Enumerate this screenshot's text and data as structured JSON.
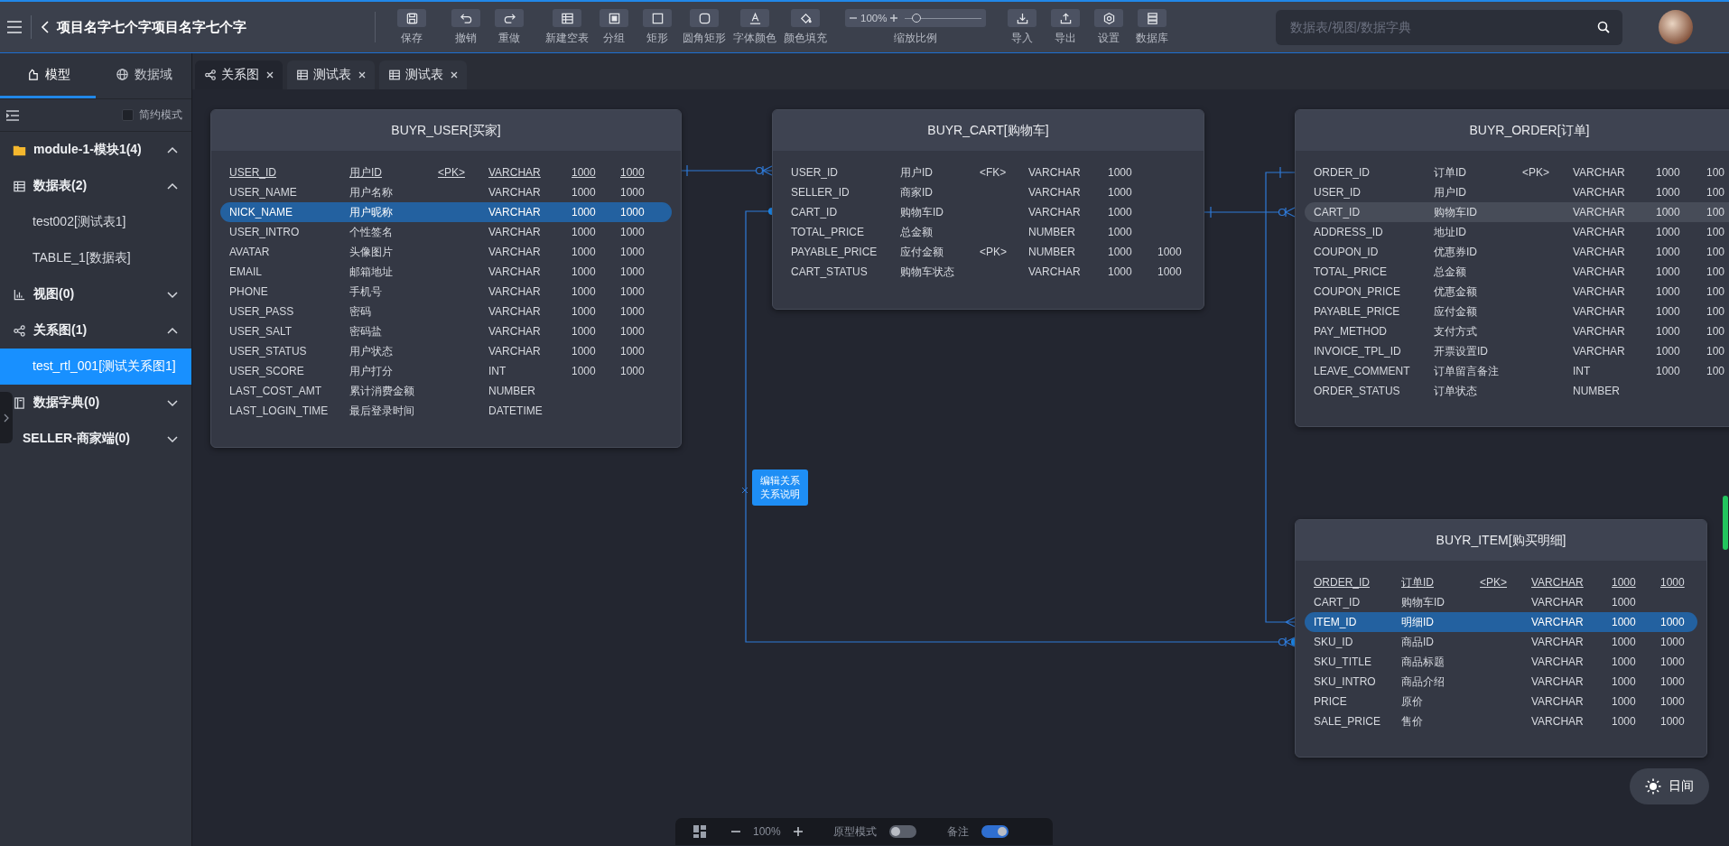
{
  "header": {
    "title": "项目名字七个字项目名字七个字"
  },
  "toolbar": {
    "groups": [
      [
        {
          "label": "保存"
        }
      ],
      [
        {
          "label": "撤销"
        },
        {
          "label": "重做"
        }
      ],
      [
        {
          "label": "新建空表"
        },
        {
          "label": "分组"
        },
        {
          "label": "矩形"
        },
        {
          "label": "圆角矩形"
        },
        {
          "label": "字体颜色"
        },
        {
          "label": "颜色填充"
        }
      ]
    ],
    "zoom": {
      "value": "100%",
      "level": 0.15,
      "label": "缩放比例"
    },
    "right_group": [
      {
        "label": "导入"
      },
      {
        "label": "导出"
      },
      {
        "label": "设置"
      },
      {
        "label": "数据库"
      }
    ]
  },
  "search": {
    "placeholder": "数据表/视图/数据字典"
  },
  "sidebar": {
    "tabs": [
      {
        "label": "模型",
        "selected": true
      },
      {
        "label": "数据域",
        "selected": false
      }
    ],
    "simple_mode": {
      "label": "简约模式",
      "checked": false
    },
    "tree": [
      {
        "label": "module-1-模块1(4)",
        "kind": "module",
        "expanded": true,
        "selected": false,
        "children": [
          {
            "label": "数据表(2)",
            "kind": "tables",
            "expanded": true,
            "selected": false,
            "children": [
              {
                "label": "test002[测试表1]",
                "selected": false
              },
              {
                "label": "TABLE_1[数据表]",
                "selected": false
              }
            ]
          },
          {
            "label": "视图(0)",
            "kind": "views",
            "expanded": false,
            "selected": false
          },
          {
            "label": "关系图(1)",
            "kind": "diagrams",
            "expanded": true,
            "selected": false,
            "children": [
              {
                "label": "test_rtl_001[测试关系图1]",
                "selected": true
              }
            ]
          },
          {
            "label": "数据字典(0)",
            "kind": "dictionaries",
            "expanded": false,
            "selected": false
          }
        ]
      },
      {
        "label": "SELLER-商家端(0)",
        "kind": "module",
        "expanded": false,
        "selected": false
      }
    ]
  },
  "tabs": [
    {
      "label": "关系图",
      "kind": "diagram",
      "selected": true
    },
    {
      "label": "测试表",
      "kind": "table",
      "selected": false
    },
    {
      "label": "测试表",
      "kind": "table",
      "selected": false
    }
  ],
  "tables": [
    {
      "title": "BUYR_USER[买家]",
      "rows": [
        {
          "name": "USER_ID",
          "comment": "用户ID",
          "key": "<PK>",
          "type": "VARCHAR",
          "length": "1000",
          "scale": "1000",
          "primary": true,
          "selected": false,
          "hovered": false
        },
        {
          "name": "USER_NAME",
          "comment": "用户名称",
          "type": "VARCHAR",
          "length": "1000",
          "scale": "1000",
          "primary": false,
          "selected": false,
          "hovered": false
        },
        {
          "name": "NICK_NAME",
          "comment": "用户昵称",
          "type": "VARCHAR",
          "length": "1000",
          "scale": "1000",
          "primary": false,
          "selected": true,
          "hovered": false
        },
        {
          "name": "USER_INTRO",
          "comment": "个性签名",
          "type": "VARCHAR",
          "length": "1000",
          "scale": "1000",
          "primary": false,
          "selected": false,
          "hovered": false
        },
        {
          "name": "AVATAR",
          "comment": "头像图片",
          "type": "VARCHAR",
          "length": "1000",
          "scale": "1000",
          "primary": false,
          "selected": false,
          "hovered": false
        },
        {
          "name": "EMAIL",
          "comment": "邮箱地址",
          "type": "VARCHAR",
          "length": "1000",
          "scale": "1000",
          "primary": false,
          "selected": false,
          "hovered": false
        },
        {
          "name": "PHONE",
          "comment": "手机号",
          "type": "VARCHAR",
          "length": "1000",
          "scale": "1000",
          "primary": false,
          "selected": false,
          "hovered": false
        },
        {
          "name": "USER_PASS",
          "comment": "密码",
          "type": "VARCHAR",
          "length": "1000",
          "scale": "1000",
          "primary": false,
          "selected": false,
          "hovered": false
        },
        {
          "name": "USER_SALT",
          "comment": "密码盐",
          "type": "VARCHAR",
          "length": "1000",
          "scale": "1000",
          "primary": false,
          "selected": false,
          "hovered": false
        },
        {
          "name": "USER_STATUS",
          "comment": "用户状态",
          "type": "VARCHAR",
          "length": "1000",
          "scale": "1000",
          "primary": false,
          "selected": false,
          "hovered": false
        },
        {
          "name": "USER_SCORE",
          "comment": "用户打分",
          "type": "INT",
          "length": "1000",
          "scale": "1000",
          "primary": false,
          "selected": false,
          "hovered": false
        },
        {
          "name": "LAST_COST_AMT",
          "comment": "累计消费金额",
          "type": "NUMBER",
          "primary": false,
          "selected": false,
          "hovered": false
        },
        {
          "name": "LAST_LOGIN_TIME",
          "comment": "最后登录时间",
          "type": "DATETIME",
          "primary": false,
          "selected": false,
          "hovered": false
        }
      ]
    },
    {
      "title": "BUYR_CART[购物车]",
      "rows": [
        {
          "name": "USER_ID",
          "comment": "用户ID",
          "key": "<FK>",
          "type": "VARCHAR",
          "length": "1000",
          "primary": false,
          "selected": false,
          "hovered": false
        },
        {
          "name": "SELLER_ID",
          "comment": "商家ID",
          "type": "VARCHAR",
          "length": "1000",
          "primary": false,
          "selected": false,
          "hovered": false
        },
        {
          "name": "CART_ID",
          "comment": "购物车ID",
          "type": "VARCHAR",
          "length": "1000",
          "primary": false,
          "selected": false,
          "hovered": false
        },
        {
          "name": "TOTAL_PRICE",
          "comment": "总金额",
          "type": "NUMBER",
          "length": "1000",
          "primary": false,
          "selected": false,
          "hovered": false
        },
        {
          "name": "PAYABLE_PRICE",
          "comment": "应付金额",
          "key": "<PK>",
          "type": "NUMBER",
          "length": "1000",
          "scale": "1000",
          "primary": false,
          "selected": false,
          "hovered": false
        },
        {
          "name": "CART_STATUS",
          "comment": "购物车状态",
          "type": "VARCHAR",
          "length": "1000",
          "scale": "1000",
          "primary": false,
          "selected": false,
          "hovered": false
        }
      ]
    },
    {
      "title": "BUYR_ORDER[订单]",
      "rows": [
        {
          "name": "ORDER_ID",
          "comment": "订单ID",
          "key": "<PK>",
          "type": "VARCHAR",
          "length": "1000",
          "scale": "100",
          "primary": false,
          "selected": false,
          "hovered": false
        },
        {
          "name": "USER_ID",
          "comment": "用户ID",
          "type": "VARCHAR",
          "length": "1000",
          "scale": "100",
          "primary": false,
          "selected": false,
          "hovered": false
        },
        {
          "name": "CART_ID",
          "comment": "购物车ID",
          "type": "VARCHAR",
          "length": "1000",
          "scale": "100",
          "primary": false,
          "selected": false,
          "hovered": true
        },
        {
          "name": "ADDRESS_ID",
          "comment": "地址ID",
          "type": "VARCHAR",
          "length": "1000",
          "scale": "100",
          "primary": false,
          "selected": false,
          "hovered": false
        },
        {
          "name": "COUPON_ID",
          "comment": "优惠券ID",
          "type": "VARCHAR",
          "length": "1000",
          "scale": "100",
          "primary": false,
          "selected": false,
          "hovered": false
        },
        {
          "name": "TOTAL_PRICE",
          "comment": "总金额",
          "type": "VARCHAR",
          "length": "1000",
          "scale": "100",
          "primary": false,
          "selected": false,
          "hovered": false
        },
        {
          "name": "COUPON_PRICE",
          "comment": "优惠金额",
          "type": "VARCHAR",
          "length": "1000",
          "scale": "100",
          "primary": false,
          "selected": false,
          "hovered": false
        },
        {
          "name": "PAYABLE_PRICE",
          "comment": "应付金额",
          "type": "VARCHAR",
          "length": "1000",
          "scale": "100",
          "primary": false,
          "selected": false,
          "hovered": false
        },
        {
          "name": "PAY_METHOD",
          "comment": "支付方式",
          "type": "VARCHAR",
          "length": "1000",
          "scale": "100",
          "primary": false,
          "selected": false,
          "hovered": false
        },
        {
          "name": "INVOICE_TPL_ID",
          "comment": "开票设置ID",
          "type": "VARCHAR",
          "length": "1000",
          "scale": "100",
          "primary": false,
          "selected": false,
          "hovered": false
        },
        {
          "name": "LEAVE_COMMENT",
          "comment": "订单留言备注",
          "type": "INT",
          "length": "1000",
          "scale": "100",
          "primary": false,
          "selected": false,
          "hovered": false
        },
        {
          "name": "ORDER_STATUS",
          "comment": "订单状态",
          "type": "NUMBER",
          "primary": false,
          "selected": false,
          "hovered": false
        }
      ]
    },
    {
      "title": "BUYR_ITEM[购买明细]",
      "rows": [
        {
          "name": "ORDER_ID",
          "comment": "订单ID",
          "key": "<PK>",
          "type": "VARCHAR",
          "length": "1000",
          "scale": "1000",
          "primary": true,
          "selected": false,
          "hovered": false
        },
        {
          "name": "CART_ID",
          "comment": "购物车ID",
          "type": "VARCHAR",
          "length": "1000",
          "primary": false,
          "selected": false,
          "hovered": false
        },
        {
          "name": "ITEM_ID",
          "comment": "明细ID",
          "type": "VARCHAR",
          "length": "1000",
          "scale": "1000",
          "primary": false,
          "selected": true,
          "hovered": false
        },
        {
          "name": "SKU_ID",
          "comment": "商品ID",
          "type": "VARCHAR",
          "length": "1000",
          "scale": "1000",
          "primary": false,
          "selected": false,
          "hovered": false
        },
        {
          "name": "SKU_TITLE",
          "comment": "商品标题",
          "type": "VARCHAR",
          "length": "1000",
          "scale": "1000",
          "primary": false,
          "selected": false,
          "hovered": false
        },
        {
          "name": "SKU_INTRO",
          "comment": "商品介绍",
          "type": "VARCHAR",
          "length": "1000",
          "scale": "1000",
          "primary": false,
          "selected": false,
          "hovered": false
        },
        {
          "name": "PRICE",
          "comment": "原价",
          "type": "VARCHAR",
          "length": "1000",
          "scale": "1000",
          "primary": false,
          "selected": false,
          "hovered": false
        },
        {
          "name": "SALE_PRICE",
          "comment": "售价",
          "type": "VARCHAR",
          "length": "1000",
          "scale": "1000",
          "primary": false,
          "selected": false,
          "hovered": false
        }
      ]
    }
  ],
  "note": {
    "lines": [
      "编辑关系",
      "关系说明"
    ]
  },
  "bottom_bar": {
    "zoom": "100%",
    "prototype_mode": {
      "label": "原型模式",
      "on": false
    },
    "notes": {
      "label": "备注",
      "on": true
    }
  },
  "theme_button": {
    "label": "日间"
  }
}
